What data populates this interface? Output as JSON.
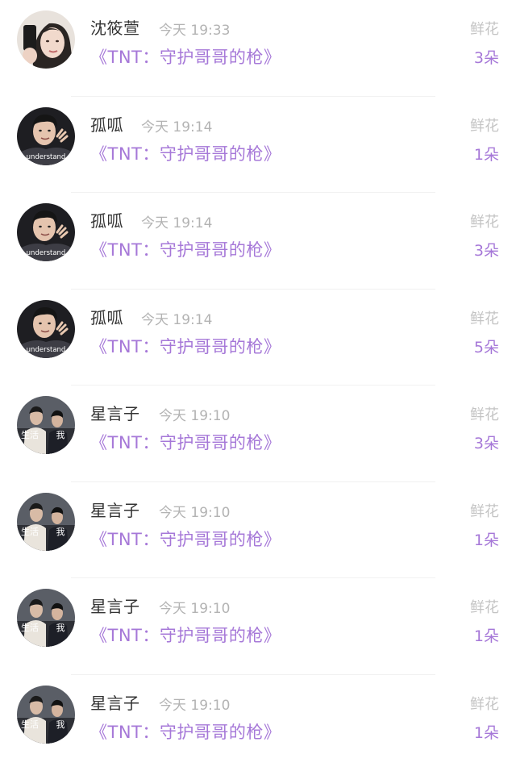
{
  "items": [
    {
      "name": "沈筱萱",
      "time": "今天 19:33",
      "title": "《TNT：守护哥哥的枪》",
      "gift_label": "鲜花",
      "gift_count": "3朵",
      "avatar": "girl-selfie"
    },
    {
      "name": "孤呱",
      "time": "今天 19:14",
      "title": "《TNT：守护哥哥的枪》",
      "gift_label": "鲜花",
      "gift_count": "1朵",
      "avatar": "boy-understand",
      "avatar_text": "understand"
    },
    {
      "name": "孤呱",
      "time": "今天 19:14",
      "title": "《TNT：守护哥哥的枪》",
      "gift_label": "鲜花",
      "gift_count": "3朵",
      "avatar": "boy-understand",
      "avatar_text": "understand"
    },
    {
      "name": "孤呱",
      "time": "今天 19:14",
      "title": "《TNT：守护哥哥的枪》",
      "gift_label": "鲜花",
      "gift_count": "5朵",
      "avatar": "boy-understand",
      "avatar_text": "understand"
    },
    {
      "name": "星言子",
      "time": "今天 19:10",
      "title": "《TNT：守护哥哥的枪》",
      "gift_label": "鲜花",
      "gift_count": "3朵",
      "avatar": "two-people",
      "avatar_text_left": "生活",
      "avatar_text_right": "我"
    },
    {
      "name": "星言子",
      "time": "今天 19:10",
      "title": "《TNT：守护哥哥的枪》",
      "gift_label": "鲜花",
      "gift_count": "1朵",
      "avatar": "two-people",
      "avatar_text_left": "生活",
      "avatar_text_right": "我"
    },
    {
      "name": "星言子",
      "time": "今天 19:10",
      "title": "《TNT：守护哥哥的枪》",
      "gift_label": "鲜花",
      "gift_count": "1朵",
      "avatar": "two-people",
      "avatar_text_left": "生活",
      "avatar_text_right": "我"
    },
    {
      "name": "星言子",
      "time": "今天 19:10",
      "title": "《TNT：守护哥哥的枪》",
      "gift_label": "鲜花",
      "gift_count": "1朵",
      "avatar": "two-people",
      "avatar_text_left": "生活",
      "avatar_text_right": "我"
    }
  ],
  "colors": {
    "accent": "#a678d8",
    "name": "#333333",
    "time": "#b3b3b3",
    "label": "#c4c4c4"
  }
}
